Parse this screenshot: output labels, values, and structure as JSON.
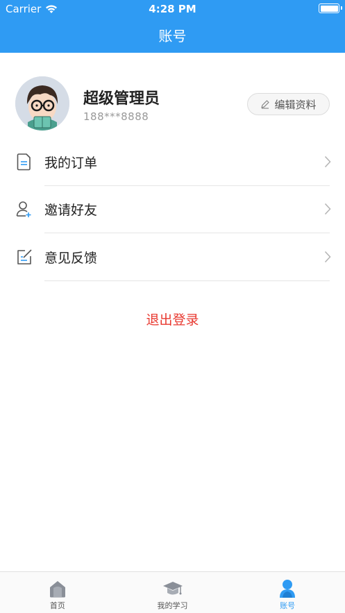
{
  "status_bar": {
    "carrier": "Carrier",
    "time": "4:28 PM"
  },
  "nav": {
    "title": "账号"
  },
  "profile": {
    "name": "超级管理员",
    "phone": "188***8888",
    "edit_label": "编辑资料"
  },
  "menu": [
    {
      "label": "我的订单",
      "icon": "order-document-icon"
    },
    {
      "label": "邀请好友",
      "icon": "invite-user-icon"
    },
    {
      "label": "意见反馈",
      "icon": "feedback-edit-icon"
    }
  ],
  "logout_label": "退出登录",
  "tabbar": {
    "tabs": [
      {
        "label": "首页",
        "icon": "home-icon",
        "active": false
      },
      {
        "label": "我的学习",
        "icon": "graduation-cap-icon",
        "active": false
      },
      {
        "label": "账号",
        "icon": "user-icon",
        "active": true
      }
    ]
  },
  "colors": {
    "primary": "#2f9bf3",
    "logout": "#e8382f",
    "divider": "#e5e5e5"
  }
}
